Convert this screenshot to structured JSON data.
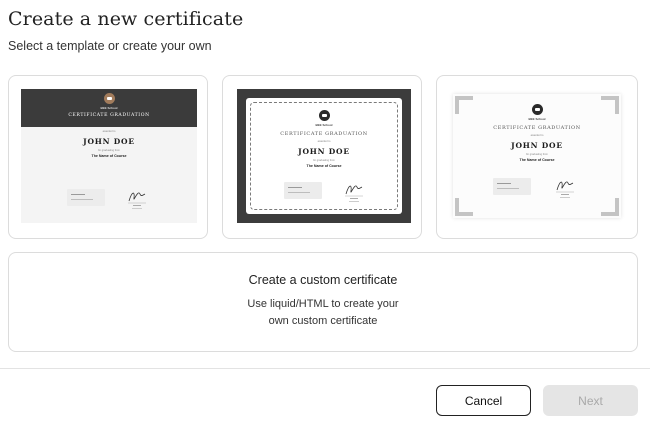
{
  "header": {
    "title": "Create a new certificate",
    "subtitle": "Select a template or create your own"
  },
  "templates": [
    {
      "school": "BEE School",
      "heading": "CERTIFICATE GRADUATION",
      "presented": "awarded to",
      "recipient": "JOHN DOE",
      "for_text": "for graduating from",
      "course": "The Name of Course",
      "info_label": "Date Achieved",
      "info_value": "Issue Date here",
      "sig_name": "Signer Name",
      "sig_title": "CEO Bee School"
    },
    {
      "school": "BEE School",
      "heading": "CERTIFICATE GRADUATION",
      "presented": "awarded to",
      "recipient": "JOHN DOE",
      "for_text": "for graduating from",
      "course": "The Name of Course",
      "info_label": "Date Achieved",
      "info_value": "Issue Date here",
      "sig_name": "Signer Name",
      "sig_title": "CEO Bee School"
    },
    {
      "school": "BEE School",
      "heading": "CERTIFICATE GRADUATION",
      "presented": "awarded to",
      "recipient": "JOHN DOE",
      "for_text": "for graduating from",
      "course": "The Name of Course",
      "info_label": "Date Achieved",
      "info_value": "Issue Date here",
      "sig_name": "Signer Name",
      "sig_title": "CEO Bee School"
    }
  ],
  "custom": {
    "title": "Create a custom certificate",
    "description_line1": "Use liquid/HTML to create your",
    "description_line2": "own custom certificate"
  },
  "footer": {
    "cancel_label": "Cancel",
    "next_label": "Next"
  },
  "colors": {
    "dark_band": "#3b3b3b",
    "seal": "#8a6a50",
    "next_disabled_bg": "#e5e5e5"
  }
}
